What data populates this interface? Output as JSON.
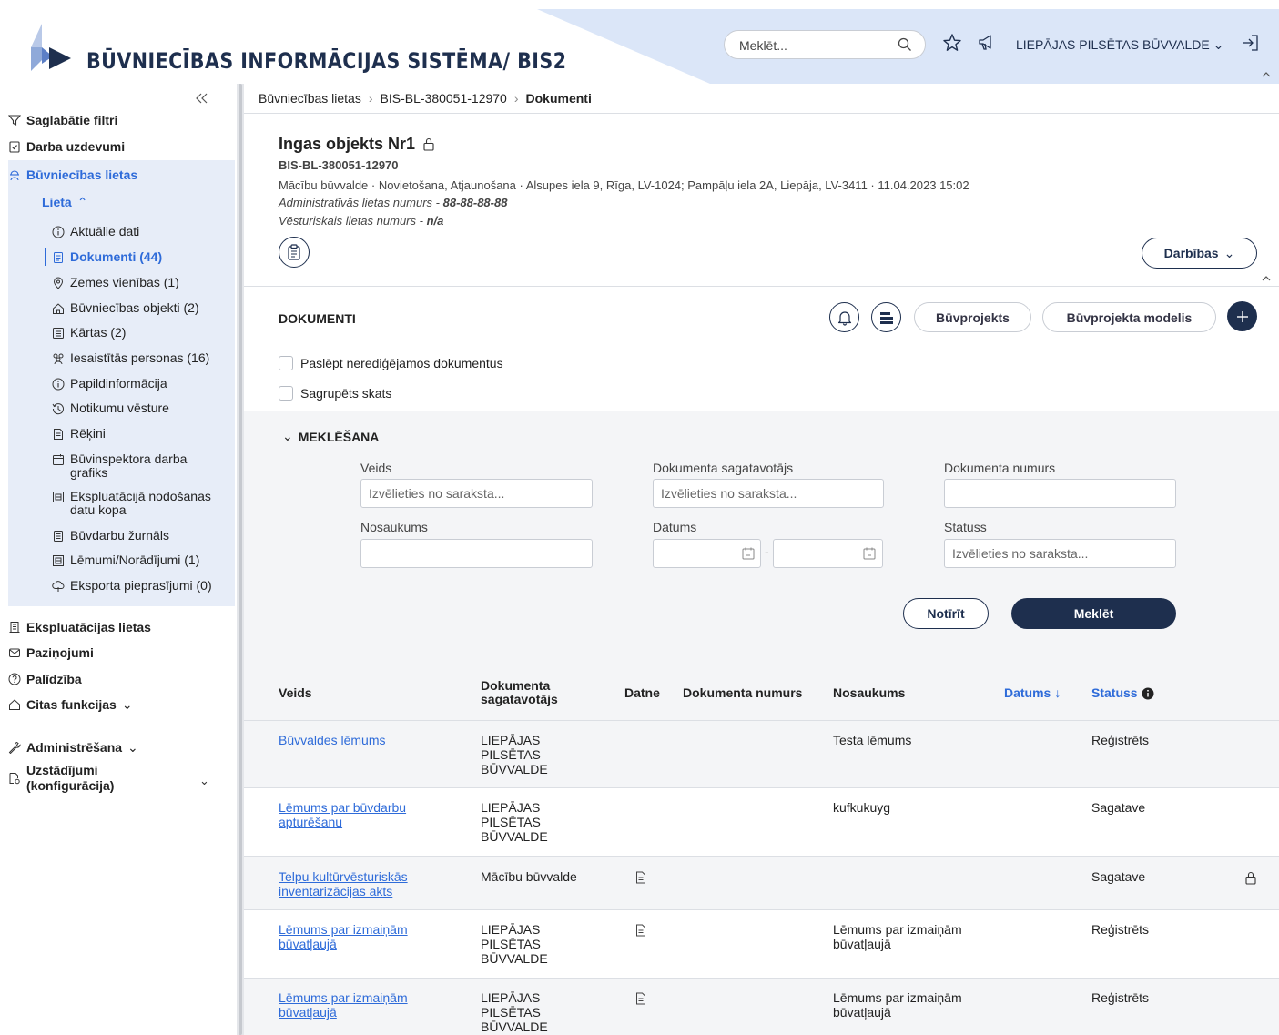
{
  "header": {
    "app_title": "BŪVNIECĪBAS INFORMĀCIJAS SISTĒMA/ BIS2",
    "search_placeholder": "Meklēt...",
    "organization": "LIEPĀJAS PILSĒTAS BŪVVALDE",
    "icons": [
      "search-icon",
      "star-icon",
      "megaphone-icon",
      "logout-icon"
    ]
  },
  "sidebar": {
    "saved_filters": "Saglabātie filtri",
    "tasks": "Darba uzdevumi",
    "construction_cases": "Būvniecības lietas",
    "case_group": "Lieta",
    "sub_items": [
      {
        "label": "Aktuālie dati",
        "icon": "info-icon"
      },
      {
        "label": "Dokumenti (44)",
        "icon": "document-icon",
        "active": true
      },
      {
        "label": "Zemes vienības (1)",
        "icon": "location-icon"
      },
      {
        "label": "Būvniecības objekti (2)",
        "icon": "house-icon"
      },
      {
        "label": "Kārtas (2)",
        "icon": "list-icon"
      },
      {
        "label": "Iesaistītās personas (16)",
        "icon": "people-icon"
      },
      {
        "label": "Papildinformācija",
        "icon": "info-icon"
      },
      {
        "label": "Notikumu vēsture",
        "icon": "history-icon"
      },
      {
        "label": "Rēķini",
        "icon": "invoice-icon"
      },
      {
        "label": "Būvinspektora darba grafiks",
        "icon": "calendar-icon"
      },
      {
        "label": "Ekspluatācijā nodošanas datu kopa",
        "icon": "dataset-icon"
      },
      {
        "label": "Būvdarbu žurnāls",
        "icon": "journal-icon"
      },
      {
        "label": "Lēmumi/Norādījumi (1)",
        "icon": "decision-icon"
      },
      {
        "label": "Eksporta pieprasījumi (0)",
        "icon": "export-icon"
      }
    ],
    "operation_cases": "Ekspluatācijas lietas",
    "notifications": "Paziņojumi",
    "help": "Palīdzība",
    "other_functions": "Citas funkcijas",
    "administration": "Administrēšana",
    "settings": "Uzstādījumi (konfigurācija)"
  },
  "breadcrumb": {
    "items": [
      "Būvniecības lietas",
      "BIS-BL-380051-12970",
      "Dokumenti"
    ]
  },
  "object": {
    "title": "Ingas objekts Nr1",
    "code": "BIS-BL-380051-12970",
    "meta": "Mācību būvvalde · Novietošana, Atjaunošana · Alsupes iela 9, Rīga, LV-1024; Pampāļu iela 2A, Liepāja, LV-3411 · 11.04.2023 15:02",
    "admin_label": "Administratīvās lietas numurs",
    "admin_value": "88-88-88-88",
    "hist_label": "Vēsturiskais lietas numurs",
    "hist_value": "n/a",
    "actions_label": "Darbības"
  },
  "documents": {
    "section_title": "DOKUMENTI",
    "buvprojekts_label": "Būvprojekts",
    "buvprojekta_modelis_label": "Būvprojekta modelis",
    "hide_noneditable_label": "Paslēpt nerediģējamos dokumentus",
    "grouped_view_label": "Sagrupēts skats"
  },
  "search": {
    "title": "MEKLĒŠANA",
    "type_label": "Veids",
    "type_placeholder": "Izvēlieties no saraksta...",
    "preparer_label": "Dokumenta sagatavotājs",
    "preparer_placeholder": "Izvēlieties no saraksta...",
    "number_label": "Dokumenta numurs",
    "name_label": "Nosaukums",
    "date_label": "Datums",
    "date_sep": "-",
    "status_label": "Statuss",
    "status_placeholder": "Izvēlieties no saraksta...",
    "clear_label": "Notīrīt",
    "search_label": "Meklēt"
  },
  "table": {
    "columns": {
      "type": "Veids",
      "preparer": "Dokumenta sagatavotājs",
      "file": "Datne",
      "number": "Dokumenta numurs",
      "name": "Nosaukums",
      "date": "Datums",
      "status": "Statuss"
    },
    "rows": [
      {
        "type": "Būvvaldes lēmums",
        "preparer": "LIEPĀJAS PILSĒTAS BŪVVALDE",
        "file": false,
        "number": "",
        "name": "Testa lēmums",
        "status": "Reģistrēts",
        "locked": false
      },
      {
        "type": "Lēmums par būvdarbu apturēšanu",
        "preparer": "LIEPĀJAS PILSĒTAS BŪVVALDE",
        "file": false,
        "number": "",
        "name": "kufkukuyg",
        "status": "Sagatave",
        "locked": false
      },
      {
        "type": "Telpu kultūrvēsturiskās inventarizācijas akts",
        "preparer": "Mācību būvvalde",
        "file": true,
        "number": "",
        "name": "",
        "status": "Sagatave",
        "locked": true
      },
      {
        "type": "Lēmums par izmaiņām būvatļaujā",
        "preparer": "LIEPĀJAS PILSĒTAS BŪVVALDE",
        "file": true,
        "number": "",
        "name": "Lēmums par izmaiņām būvatļaujā",
        "status": "Reģistrēts",
        "locked": false
      },
      {
        "type": "Lēmums par izmaiņām būvatļaujā",
        "preparer": "LIEPĀJAS PILSĒTAS BŪVVALDE",
        "file": true,
        "number": "",
        "name": "Lēmums par izmaiņām būvatļaujā",
        "status": "Reģistrēts",
        "locked": false
      }
    ]
  },
  "colors": {
    "brand_navy": "#1e2f4e",
    "link_blue": "#2e6bd9",
    "active_bg": "#e7edf8",
    "header_band": "#dbe6f8"
  }
}
